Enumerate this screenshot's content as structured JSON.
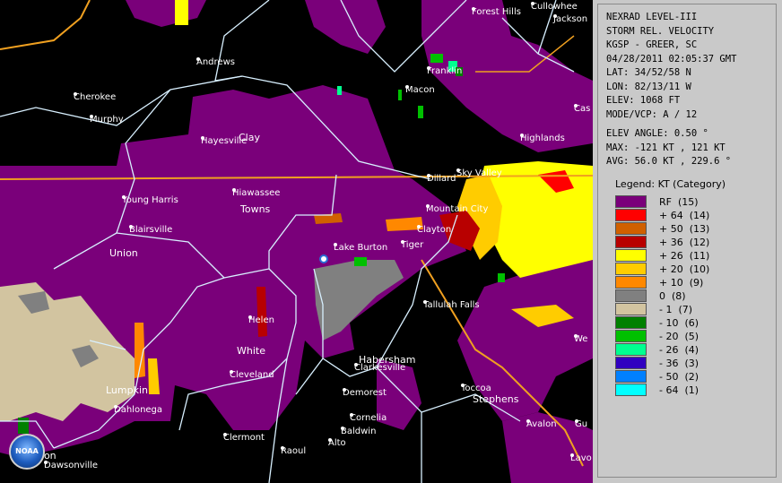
{
  "product": {
    "line1": "NEXRAD LEVEL-III",
    "line2": "STORM REL. VELOCITY",
    "site": "KGSP - GREER, SC",
    "datetime": "04/28/2011 02:05:37 GMT",
    "lat": "LAT: 34/52/58 N",
    "lon": "LON: 82/13/11 W",
    "elev": "ELEV: 1068 FT",
    "mode": "MODE/VCP: A / 12",
    "elev_angle": "ELEV ANGLE: 0.50 °",
    "max": "MAX: -121 KT , 121 KT",
    "avg": "AVG: 56.0 KT , 229.6 °"
  },
  "legend": {
    "title": "Legend: KT (Category)",
    "entries": [
      {
        "label": "RF  (15)",
        "color": "#7a007a"
      },
      {
        "label": "+ 64  (14)",
        "color": "#ff0000"
      },
      {
        "label": "+ 50  (13)",
        "color": "#d06000"
      },
      {
        "label": "+ 36  (12)",
        "color": "#b80000"
      },
      {
        "label": "+ 26  (11)",
        "color": "#ffff00"
      },
      {
        "label": "+ 20  (10)",
        "color": "#ffcc00"
      },
      {
        "label": "+ 10  (9)",
        "color": "#ff8800"
      },
      {
        "label": "0  (8)",
        "color": "#808080"
      },
      {
        "label": "- 1  (7)",
        "color": "#d2c4a0"
      },
      {
        "label": "- 10  (6)",
        "color": "#008000"
      },
      {
        "label": "- 20  (5)",
        "color": "#00c000"
      },
      {
        "label": "- 26  (4)",
        "color": "#00ff90"
      },
      {
        "label": "- 36  (3)",
        "color": "#3000c0"
      },
      {
        "label": "- 50  (2)",
        "color": "#0080ff"
      },
      {
        "label": "- 64  (1)",
        "color": "#00ffff"
      }
    ]
  },
  "places": [
    "Forest Hills",
    "Cullowhee",
    "Jackson",
    "Andrews",
    "Cherokee",
    "Franklin",
    "Macon",
    "Murphy",
    "Cas",
    "Hayesville",
    "Clay",
    "Highlands",
    "Sky Valley",
    "Dillard",
    "Young Harris",
    "Hiawassee",
    "Towns",
    "Mountain City",
    "Blairsville",
    "Clayton",
    "Lake Burton",
    "Tiger",
    "Union",
    "Tallulah Falls",
    "Helen",
    "White",
    "We",
    "Habersham",
    "Clarkesville",
    "Cleveland",
    "Lumpkin",
    "Toccoa",
    "Stephens",
    "Demorest",
    "Dahlonega",
    "Cornelia",
    "Avalon",
    "Gu",
    "Baldwin",
    "Clermont",
    "Alto",
    "Raoul",
    "Dawson",
    "Dawsonville",
    "Lavo"
  ],
  "logo": {
    "text": "NOAA"
  }
}
